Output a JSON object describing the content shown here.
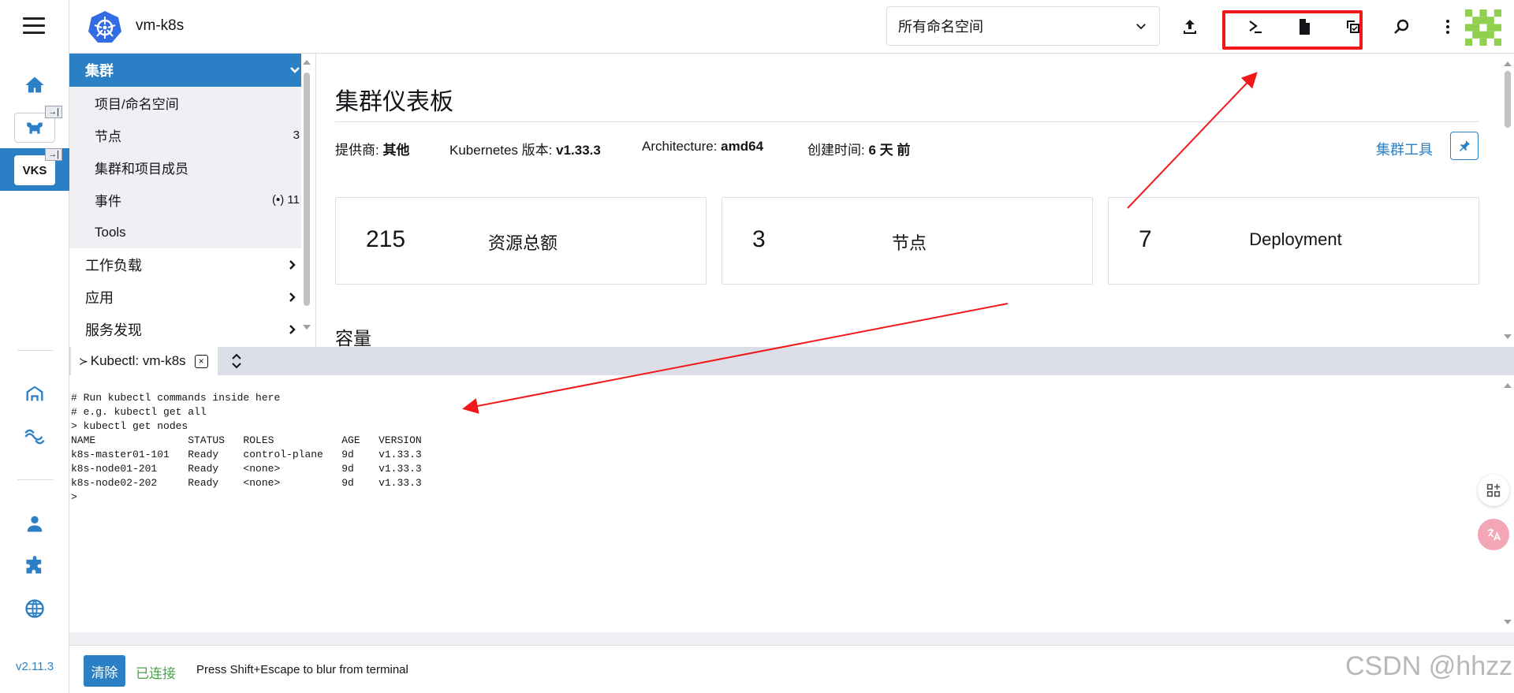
{
  "header": {
    "cluster_name": "vm-k8s",
    "namespace_select": "所有命名空间"
  },
  "rail": {
    "vks_label": "VKS",
    "version": "v2.11.3",
    "pin_glyph": "→|"
  },
  "sidenav": {
    "group_label": "集群",
    "sub_items": [
      {
        "label": "项目/命名空间",
        "count": ""
      },
      {
        "label": "节点",
        "count": "3"
      },
      {
        "label": "集群和项目成员",
        "count": ""
      },
      {
        "label": "事件",
        "count": "(•) 11"
      },
      {
        "label": "Tools",
        "count": ""
      }
    ],
    "items": [
      {
        "label": "工作负载"
      },
      {
        "label": "应用"
      },
      {
        "label": "服务发现"
      }
    ]
  },
  "dashboard": {
    "title": "集群仪表板",
    "provider_label": "提供商:",
    "provider_value": "其他",
    "k8s_label": "Kubernetes 版本:",
    "k8s_value": "v1.33.3",
    "arch_label": "Architecture:",
    "arch_value": "amd64",
    "created_label": "创建时间:",
    "created_value": "6 天 前",
    "tools_link": "集群工具",
    "cards": [
      {
        "value": "215",
        "label": "资源总额"
      },
      {
        "value": "3",
        "label": "节点"
      },
      {
        "value": "7",
        "label": "Deployment"
      }
    ],
    "capacity": "容量"
  },
  "terminal": {
    "tab_label": "Kubectl: vm-k8s",
    "tab_glyph": "≻",
    "close_glyph": "×",
    "output": "# Run kubectl commands inside here\n# e.g. kubectl get all\n> kubectl get nodes\nNAME               STATUS   ROLES           AGE   VERSION\nk8s-master01-101   Ready    control-plane   9d    v1.33.3\nk8s-node01-201     Ready    <none>          9d    v1.33.3\nk8s-node02-202     Ready    <none>          9d    v1.33.3\n>",
    "clear_button": "清除",
    "status": "已连接",
    "hint": "Press Shift+Escape to blur from terminal"
  },
  "watermark": "CSDN @hhzz",
  "colors": {
    "accent": "#2b7fc4",
    "highlight_box": "#f01818",
    "connected": "#4aa14a"
  }
}
